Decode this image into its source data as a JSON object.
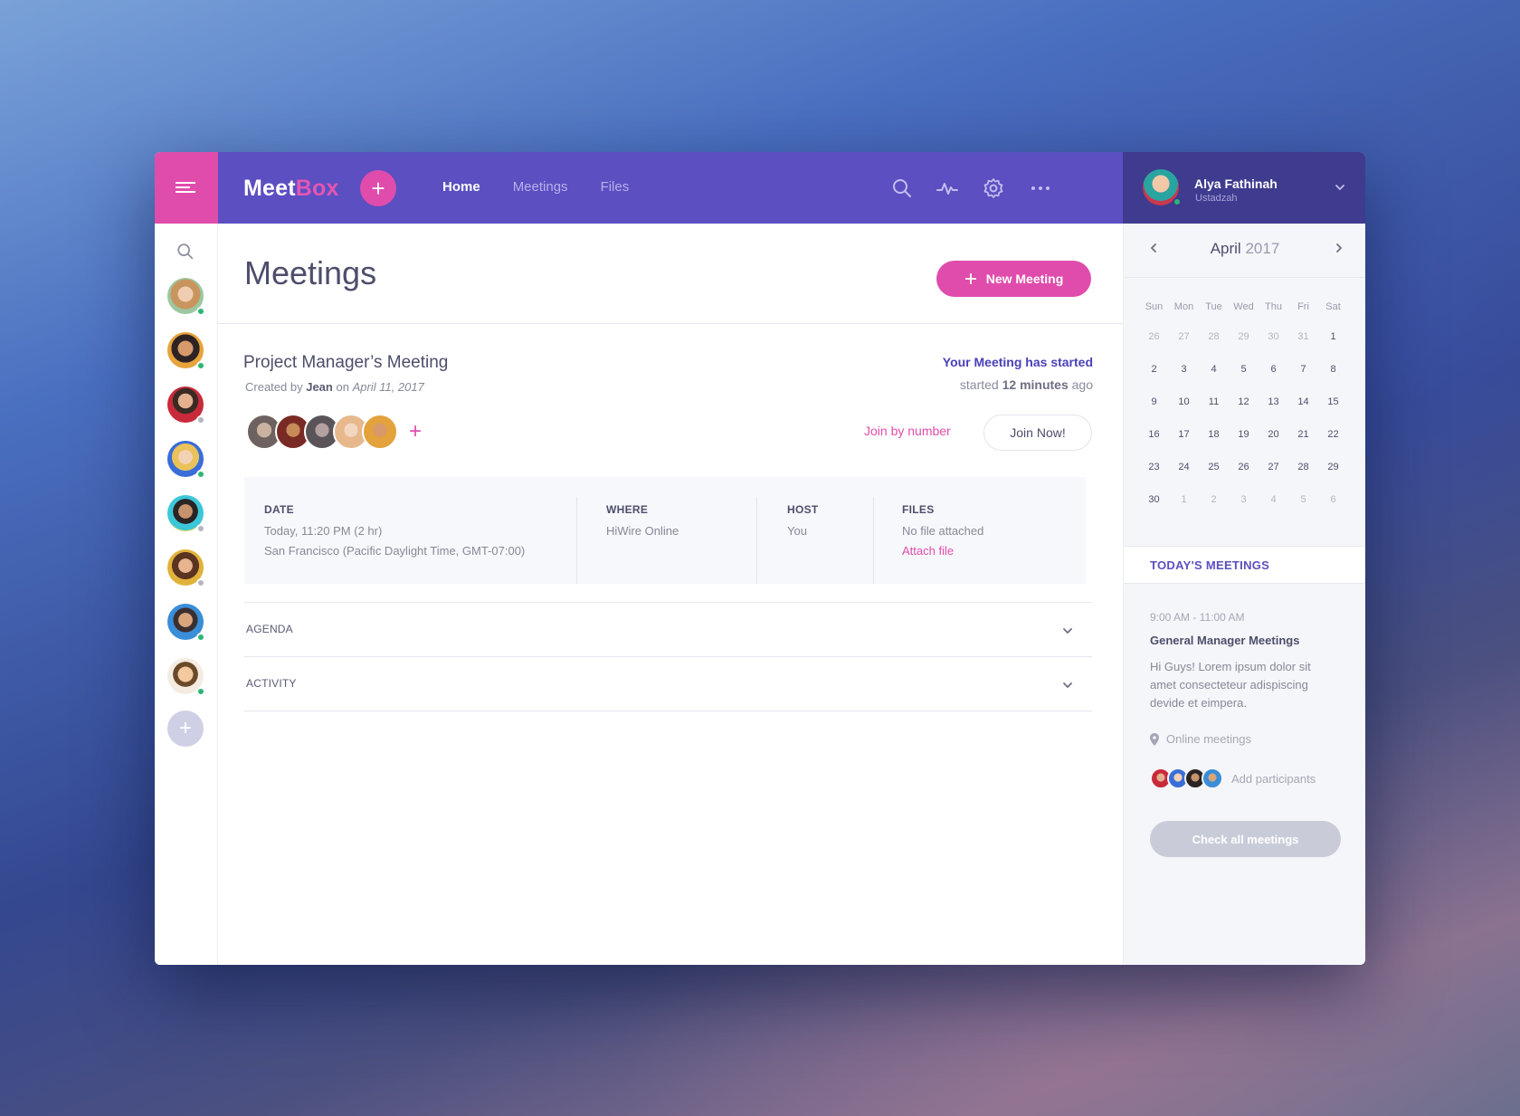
{
  "app": {
    "logo_main": "Meet",
    "logo_accent": "Box",
    "add_label": "+"
  },
  "nav": {
    "items": [
      {
        "label": "Home",
        "active": true
      },
      {
        "label": "Meetings",
        "active": false
      },
      {
        "label": "Files",
        "active": false
      }
    ]
  },
  "toolbar_icons": [
    "search-icon",
    "activity-icon",
    "settings-gear-icon",
    "more-horizontal-icon"
  ],
  "user": {
    "name": "Alya Fathinah",
    "role": "Ustadzah",
    "status": "online"
  },
  "contacts": [
    {
      "status": "online"
    },
    {
      "status": "online"
    },
    {
      "status": "offline"
    },
    {
      "status": "online"
    },
    {
      "status": "offline"
    },
    {
      "status": "offline"
    },
    {
      "status": "online"
    },
    {
      "status": "online"
    }
  ],
  "main": {
    "title": "Meetings",
    "new_meeting_label": "New Meeting"
  },
  "meeting": {
    "title": "Project Manager’s Meeting",
    "created_prefix": "Created by",
    "created_by": "Jean",
    "created_on_prefix": "on",
    "created_date": "April 11, 2017",
    "started_title": "Your Meeting has started",
    "started_prefix": "started",
    "started_duration": "12 minutes",
    "started_suffix": "ago",
    "participants_count": 5,
    "add_participant": "+",
    "join_by_number": "Join by number",
    "join_now": "Join Now!",
    "details": {
      "date_label": "DATE",
      "date_line1": "Today, 11:20 PM (2 hr)",
      "date_line2": "San Francisco (Pacific Daylight Time, GMT-07:00)",
      "where_label": "WHERE",
      "where_value": "HiWire Online",
      "host_label": "HOST",
      "host_value": "You",
      "files_label": "FILES",
      "files_value": "No file attached",
      "attach_file": "Attach file"
    },
    "sections": [
      "AGENDA",
      "ACTIVITY"
    ]
  },
  "calendar": {
    "month": "April",
    "year": "2017",
    "weekdays": [
      "Sun",
      "Mon",
      "Tue",
      "Wed",
      "Thu",
      "Fri",
      "Sat"
    ],
    "days": [
      {
        "d": "26",
        "m": true
      },
      {
        "d": "27",
        "m": true
      },
      {
        "d": "28",
        "m": true
      },
      {
        "d": "29",
        "m": true
      },
      {
        "d": "30",
        "m": true
      },
      {
        "d": "31",
        "m": true
      },
      {
        "d": "1",
        "m": false
      },
      {
        "d": "2",
        "m": false
      },
      {
        "d": "3",
        "m": false
      },
      {
        "d": "4",
        "m": false
      },
      {
        "d": "5",
        "m": false
      },
      {
        "d": "6",
        "m": false
      },
      {
        "d": "7",
        "m": false
      },
      {
        "d": "8",
        "m": false
      },
      {
        "d": "9",
        "m": false
      },
      {
        "d": "10",
        "m": false
      },
      {
        "d": "11",
        "m": false
      },
      {
        "d": "12",
        "m": false
      },
      {
        "d": "13",
        "m": false
      },
      {
        "d": "14",
        "m": false
      },
      {
        "d": "15",
        "m": false
      },
      {
        "d": "16",
        "m": false
      },
      {
        "d": "17",
        "m": false
      },
      {
        "d": "18",
        "m": false
      },
      {
        "d": "19",
        "m": false
      },
      {
        "d": "20",
        "m": false
      },
      {
        "d": "21",
        "m": false
      },
      {
        "d": "22",
        "m": false
      },
      {
        "d": "23",
        "m": false
      },
      {
        "d": "24",
        "m": false
      },
      {
        "d": "25",
        "m": false
      },
      {
        "d": "26",
        "m": false
      },
      {
        "d": "27",
        "m": false
      },
      {
        "d": "28",
        "m": false
      },
      {
        "d": "29",
        "m": false
      },
      {
        "d": "30",
        "m": false
      },
      {
        "d": "1",
        "m": true
      },
      {
        "d": "2",
        "m": true
      },
      {
        "d": "3",
        "m": true
      },
      {
        "d": "4",
        "m": true
      },
      {
        "d": "5",
        "m": true
      },
      {
        "d": "6",
        "m": true
      }
    ]
  },
  "today": {
    "heading": "TODAY'S MEETINGS",
    "time": "9:00 AM - 11:00 AM",
    "title": "General Manager Meetings",
    "description": "Hi Guys! Lorem ipsum dolor sit amet consecteteur adispiscing devide et eimpera.",
    "location": "Online meetings",
    "add_participants": "Add participants",
    "check_all": "Check all meetings"
  },
  "colors": {
    "brand_pink": "#e04cac",
    "topbar_purple": "#5b4fc1",
    "profile_purple": "#3f3b8f",
    "online_green": "#2bb673",
    "offline_grey": "#b5b6c4"
  }
}
